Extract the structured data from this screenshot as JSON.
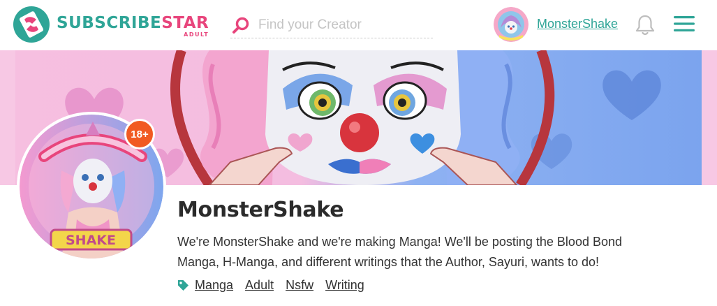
{
  "brand": {
    "name_part1": "SUBSCRIBE",
    "name_part2": "STAR",
    "sub": "ADULT",
    "colors": {
      "teal": "#2fa597",
      "pink": "#e8457c"
    }
  },
  "search": {
    "placeholder": "Find your Creator",
    "icon": "search-icon"
  },
  "user": {
    "name": "MonsterShake"
  },
  "header_icons": [
    "bell-icon",
    "hamburger-menu-icon"
  ],
  "creator": {
    "name": "MonsterShake",
    "age_badge": "18+",
    "bio": "We're MonsterShake and we're making Manga! We'll be posting the Blood Bond Manga, H-Manga, and different writings that the Author, Sayuri, wants to do!",
    "tags": [
      "Manga",
      "Adult",
      "Nsfw",
      "Writing"
    ],
    "badge_color": "#f15a22"
  }
}
